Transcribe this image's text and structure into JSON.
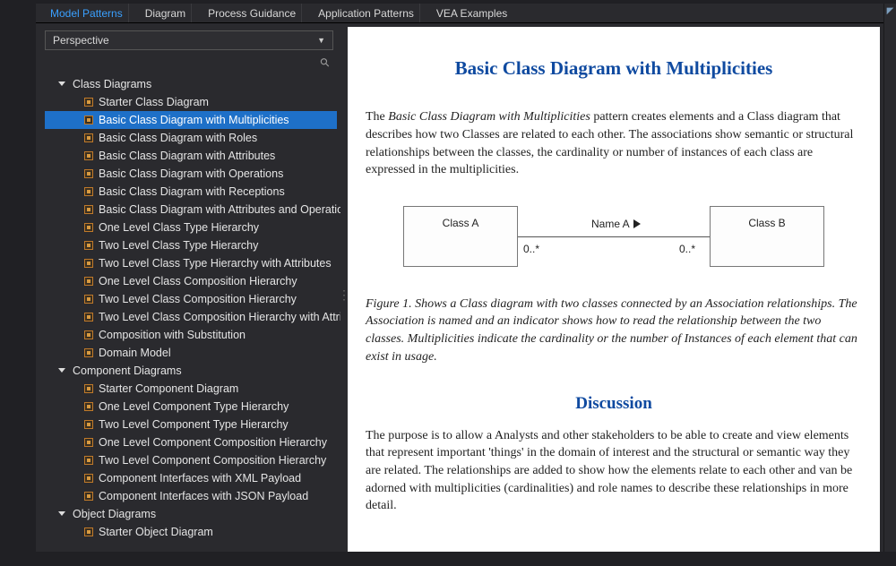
{
  "tabs": [
    {
      "label": "Model Patterns",
      "active": true
    },
    {
      "label": "Diagram",
      "active": false
    },
    {
      "label": "Process Guidance",
      "active": false
    },
    {
      "label": "Application Patterns",
      "active": false
    },
    {
      "label": "VEA Examples",
      "active": false
    }
  ],
  "combo": {
    "label": "Perspective"
  },
  "tree": [
    {
      "type": "group",
      "label": "Class Diagrams",
      "open": true
    },
    {
      "type": "item",
      "label": "Starter Class Diagram"
    },
    {
      "type": "item",
      "label": "Basic Class Diagram with Multiplicities",
      "selected": true
    },
    {
      "type": "item",
      "label": "Basic Class Diagram with Roles"
    },
    {
      "type": "item",
      "label": "Basic Class Diagram with Attributes"
    },
    {
      "type": "item",
      "label": "Basic Class Diagram with Operations"
    },
    {
      "type": "item",
      "label": "Basic Class Diagram with Receptions"
    },
    {
      "type": "item",
      "label": "Basic Class Diagram with Attributes and Operations"
    },
    {
      "type": "item",
      "label": "One Level Class Type Hierarchy"
    },
    {
      "type": "item",
      "label": "Two Level Class Type Hierarchy"
    },
    {
      "type": "item",
      "label": "Two Level Class Type Hierarchy with Attributes"
    },
    {
      "type": "item",
      "label": "One Level Class Composition Hierarchy"
    },
    {
      "type": "item",
      "label": "Two Level Class Composition Hierarchy"
    },
    {
      "type": "item",
      "label": "Two Level Class Composition Hierarchy with Attributes"
    },
    {
      "type": "item",
      "label": "Composition with Substitution"
    },
    {
      "type": "item",
      "label": "Domain Model"
    },
    {
      "type": "group",
      "label": "Component Diagrams",
      "open": true
    },
    {
      "type": "item",
      "label": "Starter Component Diagram"
    },
    {
      "type": "item",
      "label": "One Level Component Type Hierarchy"
    },
    {
      "type": "item",
      "label": "Two Level Component Type Hierarchy"
    },
    {
      "type": "item",
      "label": "One Level Component Composition Hierarchy"
    },
    {
      "type": "item",
      "label": "Two Level Component Composition Hierarchy"
    },
    {
      "type": "item",
      "label": "Component Interfaces with XML Payload"
    },
    {
      "type": "item",
      "label": "Component Interfaces with JSON Payload"
    },
    {
      "type": "group",
      "label": "Object Diagrams",
      "open": true
    },
    {
      "type": "item",
      "label": "Starter Object Diagram"
    }
  ],
  "doc": {
    "title": "Basic Class Diagram with Multiplicities",
    "para1_prefix": "The ",
    "para1_em": "Basic Class Diagram with Multiplicities",
    "para1_rest": " pattern creates elements and a Class diagram that describes how two Classes are related to each other. The associations show semantic or structural relationships between the classes, the cardinality or number of instances of each class are expressed in the multiplicities.",
    "diagram": {
      "classA": "Class A",
      "classB": "Class B",
      "assocName": "Name A",
      "multA": "0..*",
      "multB": "0..*"
    },
    "figcap": "Figure 1. Shows a Class diagram with two classes connected by an Association relationships. The Association is named and an indicator shows how to read the relationship between the two classes. Multiplicities indicate the cardinality or the number of Instances of each element that can exist in usage.",
    "h2": "Discussion",
    "para2": "The purpose is to allow a Analysts and other stakeholders to be able to create and view elements that represent important 'things' in the domain of interest and the structural or semantic way they are related.  The relationships are added to show how the elements relate to each other and van be adorned with multiplicities (cardinalities) and role names to describe these relationships in more detail."
  }
}
